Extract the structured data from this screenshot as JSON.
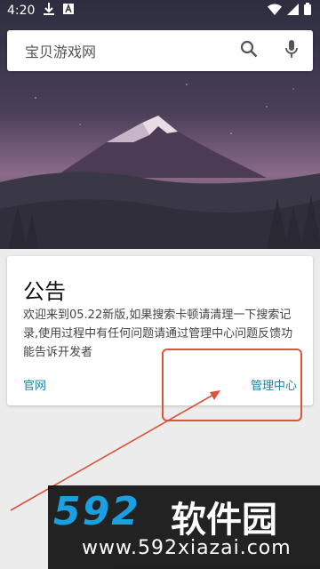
{
  "status_bar": {
    "time": "4:20"
  },
  "search": {
    "text": "宝贝游戏网"
  },
  "notice": {
    "title": "公告",
    "body": "欢迎来到05.22新版,如果搜索卡顿请清理一下搜索记录,使用过程中有任何问题请通过管理中心问题反馈功能告诉开发者",
    "link_left": "官网",
    "link_right": "管理中心"
  },
  "watermark": {
    "logo": "592",
    "name": "软件园",
    "url": "www.592xiazai.com"
  },
  "colors": {
    "accent_link": "#1f7fa0",
    "annotation": "#d9553b",
    "watermark_blue": "#1aa0e0"
  }
}
